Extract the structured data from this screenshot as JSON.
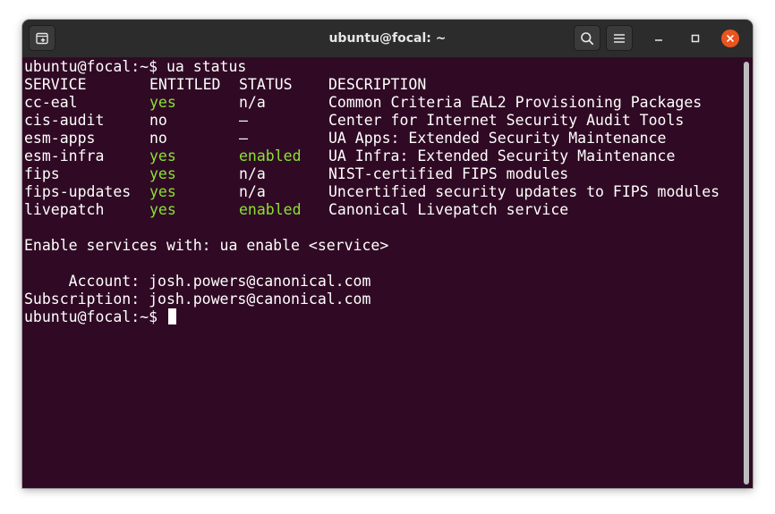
{
  "window": {
    "title": "ubuntu@focal: ~"
  },
  "icons": {
    "new_tab": "new-tab-icon",
    "search": "search-icon",
    "menu": "hamburger-menu-icon",
    "minimize": "minimize-icon",
    "maximize": "maximize-icon",
    "close": "close-icon"
  },
  "colors": {
    "terminal_bg": "#300a24",
    "text": "#ffffff",
    "green": "#8ae234",
    "close": "#e9541f"
  },
  "terminal": {
    "prompt": "ubuntu@focal:~$",
    "command": "ua status",
    "headers": {
      "service": "SERVICE",
      "entitled": "ENTITLED",
      "status": "STATUS",
      "description": "DESCRIPTION"
    },
    "rows": [
      {
        "service": "cc-eal",
        "entitled": "yes",
        "status": "n/a",
        "description": "Common Criteria EAL2 Provisioning Packages"
      },
      {
        "service": "cis-audit",
        "entitled": "no",
        "status": "—",
        "description": "Center for Internet Security Audit Tools"
      },
      {
        "service": "esm-apps",
        "entitled": "no",
        "status": "—",
        "description": "UA Apps: Extended Security Maintenance"
      },
      {
        "service": "esm-infra",
        "entitled": "yes",
        "status": "enabled",
        "description": "UA Infra: Extended Security Maintenance"
      },
      {
        "service": "fips",
        "entitled": "yes",
        "status": "n/a",
        "description": "NIST-certified FIPS modules"
      },
      {
        "service": "fips-updates",
        "entitled": "yes",
        "status": "n/a",
        "description": "Uncertified security updates to FIPS modules"
      },
      {
        "service": "livepatch",
        "entitled": "yes",
        "status": "enabled",
        "description": "Canonical Livepatch service"
      }
    ],
    "enable_hint": "Enable services with: ua enable <service>",
    "account_line": "     Account: josh.powers@canonical.com",
    "subscription_line": "Subscription: josh.powers@canonical.com"
  }
}
